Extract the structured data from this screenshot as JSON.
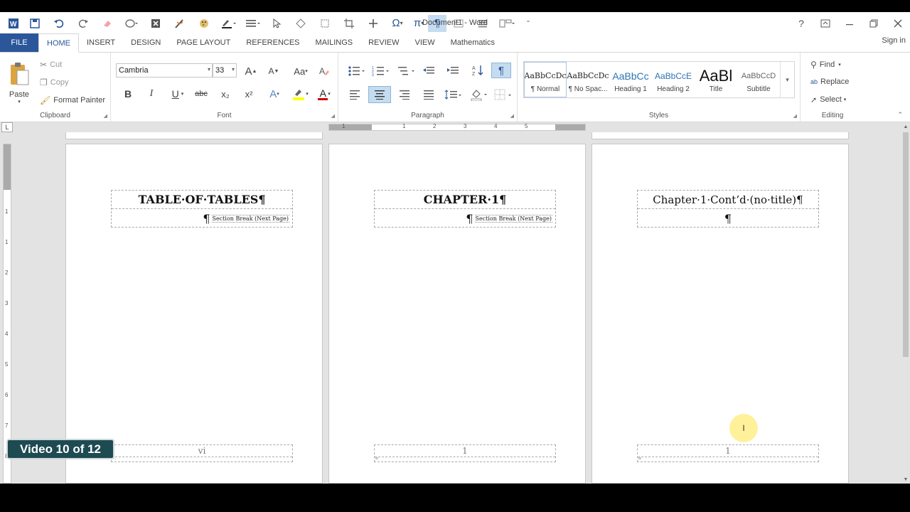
{
  "window": {
    "title": "Document1 - Word",
    "help": "?",
    "sign_in": "Sign in"
  },
  "qat": {
    "icons": [
      "word-logo-icon",
      "save-icon",
      "undo-icon",
      "redo-icon",
      "eraser-icon",
      "shape-icon",
      "close-box-icon",
      "pen-icon",
      "palette-icon",
      "underline-color-icon",
      "lines-icon",
      "pointer-icon",
      "shapes-icon",
      "select-icon",
      "crop-icon",
      "move-icon",
      "omega-icon",
      "pi-icon",
      "pilcrow-icon",
      "textbox-icon",
      "align-icon",
      "layout-icon",
      "more-icon"
    ],
    "omega": "Ω",
    "pi": "π",
    "pilcrow": "¶"
  },
  "tabs": [
    "FILE",
    "HOME",
    "INSERT",
    "DESIGN",
    "PAGE LAYOUT",
    "REFERENCES",
    "MAILINGS",
    "REVIEW",
    "VIEW",
    "Mathematics"
  ],
  "active_tab": "HOME",
  "ribbon": {
    "clipboard": {
      "label": "Clipboard",
      "paste": "Paste",
      "cut": "Cut",
      "copy": "Copy",
      "format_painter": "Format Painter"
    },
    "font": {
      "label": "Font",
      "font_name": "Cambria",
      "font_size": "33",
      "bold": "B",
      "italic": "I",
      "underline": "U",
      "strike": "abc",
      "subscript": "x₂",
      "superscript": "x²",
      "grow": "A",
      "shrink": "A",
      "case": "Aa",
      "text_effects": "A",
      "font_color": "A"
    },
    "paragraph": {
      "label": "Paragraph",
      "pilcrow": "¶"
    },
    "styles": {
      "label": "Styles",
      "items": [
        {
          "preview": "AaBbCcDc",
          "name": "¶ Normal"
        },
        {
          "preview": "AaBbCcDc",
          "name": "¶ No Spac..."
        },
        {
          "preview": "AaBbCc",
          "name": "Heading 1"
        },
        {
          "preview": "AaBbCcE",
          "name": "Heading 2"
        },
        {
          "preview": "AaBl",
          "name": "Title"
        },
        {
          "preview": "AaBbCcD",
          "name": "Subtitle"
        }
      ]
    },
    "editing": {
      "label": "Editing",
      "find": "Find",
      "replace": "Replace",
      "select": "Select"
    }
  },
  "ruler": {
    "corner": "L",
    "h_ticks": [
      "1",
      "1",
      "2",
      "3",
      "4",
      "5"
    ],
    "v_ticks": [
      "1",
      "1",
      "2",
      "3",
      "4",
      "5",
      "6",
      "7",
      "8"
    ]
  },
  "pages": [
    {
      "header_line1": "TABLE·OF·TABLES¶",
      "header_bold": true,
      "pilcrow": "¶",
      "section_break": "Section Break (Next Page)",
      "footer_num": "vi",
      "footer_mark": "␂"
    },
    {
      "header_line1": "CHAPTER·1¶",
      "header_bold": true,
      "pilcrow": "¶",
      "section_break": "Section Break (Next Page)",
      "footer_num": "1",
      "footer_mark": "¤"
    },
    {
      "header_line1": "Chapter·1·Cont’d·(no·title)¶",
      "header_bold": false,
      "pilcrow": "¶",
      "section_break": "",
      "footer_num": "1",
      "footer_mark": "¤"
    }
  ],
  "cursor": "I",
  "video_badge": "Video 10 of 12",
  "colors": {
    "file_tab": "#2b579a",
    "badge_bg": "#1e4a52",
    "highlight": "#ffec78"
  }
}
